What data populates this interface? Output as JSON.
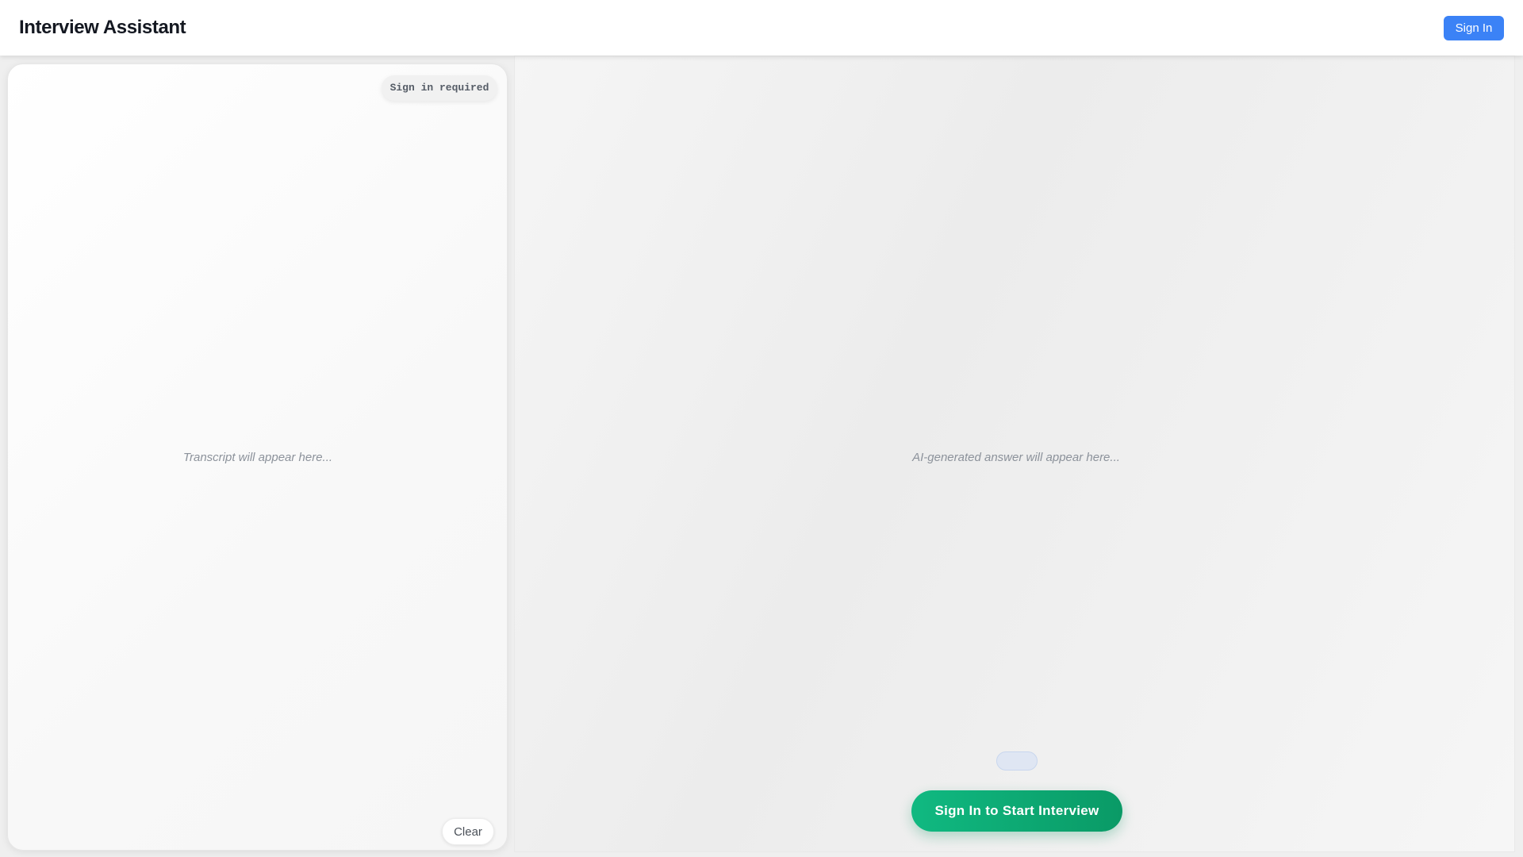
{
  "header": {
    "title": "Interview Assistant",
    "sign_in_label": "Sign In"
  },
  "transcript_panel": {
    "status": "Sign in required",
    "placeholder": "Transcript will appear here...",
    "clear_label": "Clear"
  },
  "answer_panel": {
    "placeholder": "AI-generated answer will appear here...",
    "start_label": "Sign In to Start Interview"
  },
  "colors": {
    "primary": "#3b82f6",
    "accent_green": "#10b981",
    "placeholder_text": "#8c929b"
  }
}
